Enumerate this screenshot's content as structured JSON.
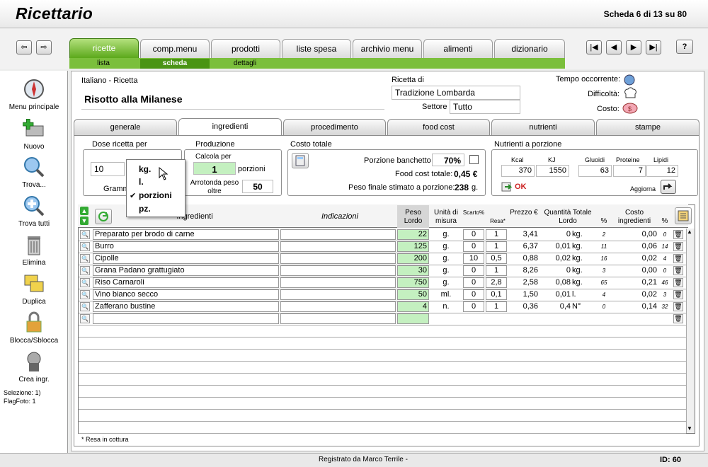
{
  "app": {
    "title": "Ricettario",
    "scheda_info": "Scheda 6 di 13 su 80"
  },
  "nav": {
    "tabs": [
      "ricette",
      "comp.menu",
      "prodotti",
      "liste spesa",
      "archivio menu",
      "alimenti",
      "dizionario"
    ],
    "subtabs": [
      "lista",
      "scheda",
      "dettagli"
    ],
    "help": "?"
  },
  "sidebar": {
    "items": [
      "Menu principale",
      "Nuovo",
      "Trova...",
      "Trova tutti",
      "Elimina",
      "Duplica",
      "Blocca/Sblocca",
      "Crea ingr."
    ],
    "selezione": "Selezione:  1)",
    "flagfoto": "FlagFoto: 1"
  },
  "header": {
    "lang_label": "Italiano - Ricetta",
    "recipe_name": "Risotto alla Milanese",
    "ricetta_di_label": "Ricetta di",
    "ricetta_di": "Tradizione Lombarda",
    "settore_label": "Settore",
    "settore": "Tutto",
    "tempo_label": "Tempo occorrente:",
    "difficolta_label": "Difficoltà:",
    "costo_label": "Costo:"
  },
  "section_tabs": [
    "generale",
    "ingredienti",
    "procedimento",
    "food cost",
    "nutrienti",
    "stampe"
  ],
  "dose": {
    "label": "Dose ricetta per",
    "value": "10",
    "unit_short": "Gramm",
    "produzione_label": "Produzione",
    "calcola_label": "Calcola per",
    "calcola_value": "1",
    "calcola_unit": "porzioni",
    "arrotonda_label": "Arrotonda peso oltre",
    "arrotonda_value": "50"
  },
  "dropdown": {
    "options": [
      "kg.",
      "l.",
      "porzioni",
      "pz."
    ],
    "selected_mark": "✔"
  },
  "costo": {
    "label": "Costo totale",
    "banchetto_label": "Porzione banchetto",
    "banchetto_value": "70%",
    "food_cost_label": "Food cost totale:",
    "food_cost_value": "0,45 €",
    "peso_label": "Peso finale stimato a porzione:",
    "peso_value": "238",
    "peso_unit": "g."
  },
  "nutrienti": {
    "label": "Nutrienti a porzione",
    "headers": [
      "Kcal",
      "KJ",
      "Gluoidi",
      "Proteine",
      "Lipidi"
    ],
    "values": [
      "370",
      "1550",
      "63",
      "7",
      "12"
    ],
    "ok": "OK",
    "aggiorna": "Aggiorna"
  },
  "table": {
    "headers": {
      "ingredienti": "Ingredienti",
      "indicazioni": "Indicazioni",
      "peso": "Peso Lordo",
      "unita": "Unità di misura",
      "scarto": "Scarto%",
      "resa": "Resa*",
      "prezzo": "Prezzo €",
      "quantita": "Quantità Totale Lordo",
      "pct": "%",
      "costo": "Costo ingredienti",
      "pct2": "%"
    },
    "rows": [
      {
        "name": "Preparato per brodo di carne",
        "peso": "22",
        "unit": "g.",
        "scarto": "0",
        "resa": "1",
        "prezzo": "3,41",
        "qta": "0",
        "qunit": "kg.",
        "p1": "2",
        "costo": "0,00",
        "p2": "0"
      },
      {
        "name": "Burro",
        "peso": "125",
        "unit": "g.",
        "scarto": "0",
        "resa": "1",
        "prezzo": "6,37",
        "qta": "0,01",
        "qunit": "kg.",
        "p1": "11",
        "costo": "0,06",
        "p2": "14"
      },
      {
        "name": "Cipolle",
        "peso": "200",
        "unit": "g.",
        "scarto": "10",
        "resa": "0,5",
        "prezzo": "0,88",
        "qta": "0,02",
        "qunit": "kg.",
        "p1": "16",
        "costo": "0,02",
        "p2": "4"
      },
      {
        "name": "Grana Padano grattugiato",
        "peso": "30",
        "unit": "g.",
        "scarto": "0",
        "resa": "1",
        "prezzo": "8,26",
        "qta": "0",
        "qunit": "kg.",
        "p1": "3",
        "costo": "0,00",
        "p2": "0"
      },
      {
        "name": "Riso Carnaroli",
        "peso": "750",
        "unit": "g.",
        "scarto": "0",
        "resa": "2,8",
        "prezzo": "2,58",
        "qta": "0,08",
        "qunit": "kg.",
        "p1": "65",
        "costo": "0,21",
        "p2": "46"
      },
      {
        "name": "Vino bianco secco",
        "peso": "50",
        "unit": "ml.",
        "scarto": "0",
        "resa": "0,1",
        "prezzo": "1,50",
        "qta": "0,01",
        "qunit": "l.",
        "p1": "4",
        "costo": "0,02",
        "p2": "3"
      },
      {
        "name": "Zafferano bustine",
        "peso": "4",
        "unit": "n.",
        "scarto": "0",
        "resa": "1",
        "prezzo": "0,36",
        "qta": "0,4",
        "qunit": "N°",
        "p1": "0",
        "costo": "0,14",
        "p2": "32"
      }
    ],
    "footnote": "* Resa in cottura"
  },
  "footer": {
    "registrato": "Registrato da Marco Terrile -",
    "id": "ID: 60"
  },
  "colors": {
    "tab_green": "#5ca91b",
    "field_green": "#c4f0c0"
  }
}
